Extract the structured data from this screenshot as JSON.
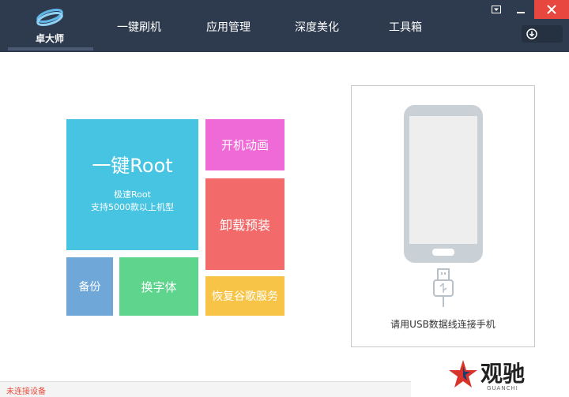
{
  "app": {
    "logo_text": "卓大师"
  },
  "nav": {
    "items": [
      {
        "label": "一键刷机"
      },
      {
        "label": "应用管理"
      },
      {
        "label": "深度美化"
      },
      {
        "label": "工具箱"
      }
    ]
  },
  "tiles": {
    "root_title": "一键Root",
    "root_line1": "极速Root",
    "root_line2": "支持5000款以上机型",
    "boot_animation": "开机动画",
    "uninstall_preinstalled": "卸载预装",
    "backup": "备份",
    "change_font": "换字体",
    "restore_google": "恢复谷歌服务"
  },
  "device": {
    "hint": "请用USB数据线连接手机"
  },
  "status": {
    "text": "未连接设备"
  },
  "watermark": {
    "text": "观驰",
    "sub": "GUANCHI"
  },
  "colors": {
    "titlebar": "#2e3a4e",
    "root": "#46c4e2",
    "boot_animation": "#ef6ad6",
    "uninstall": "#f26a6a",
    "backup": "#6ea7d8",
    "change_font": "#5ed48d",
    "restore_google": "#f7c447",
    "close": "#e8473f"
  }
}
